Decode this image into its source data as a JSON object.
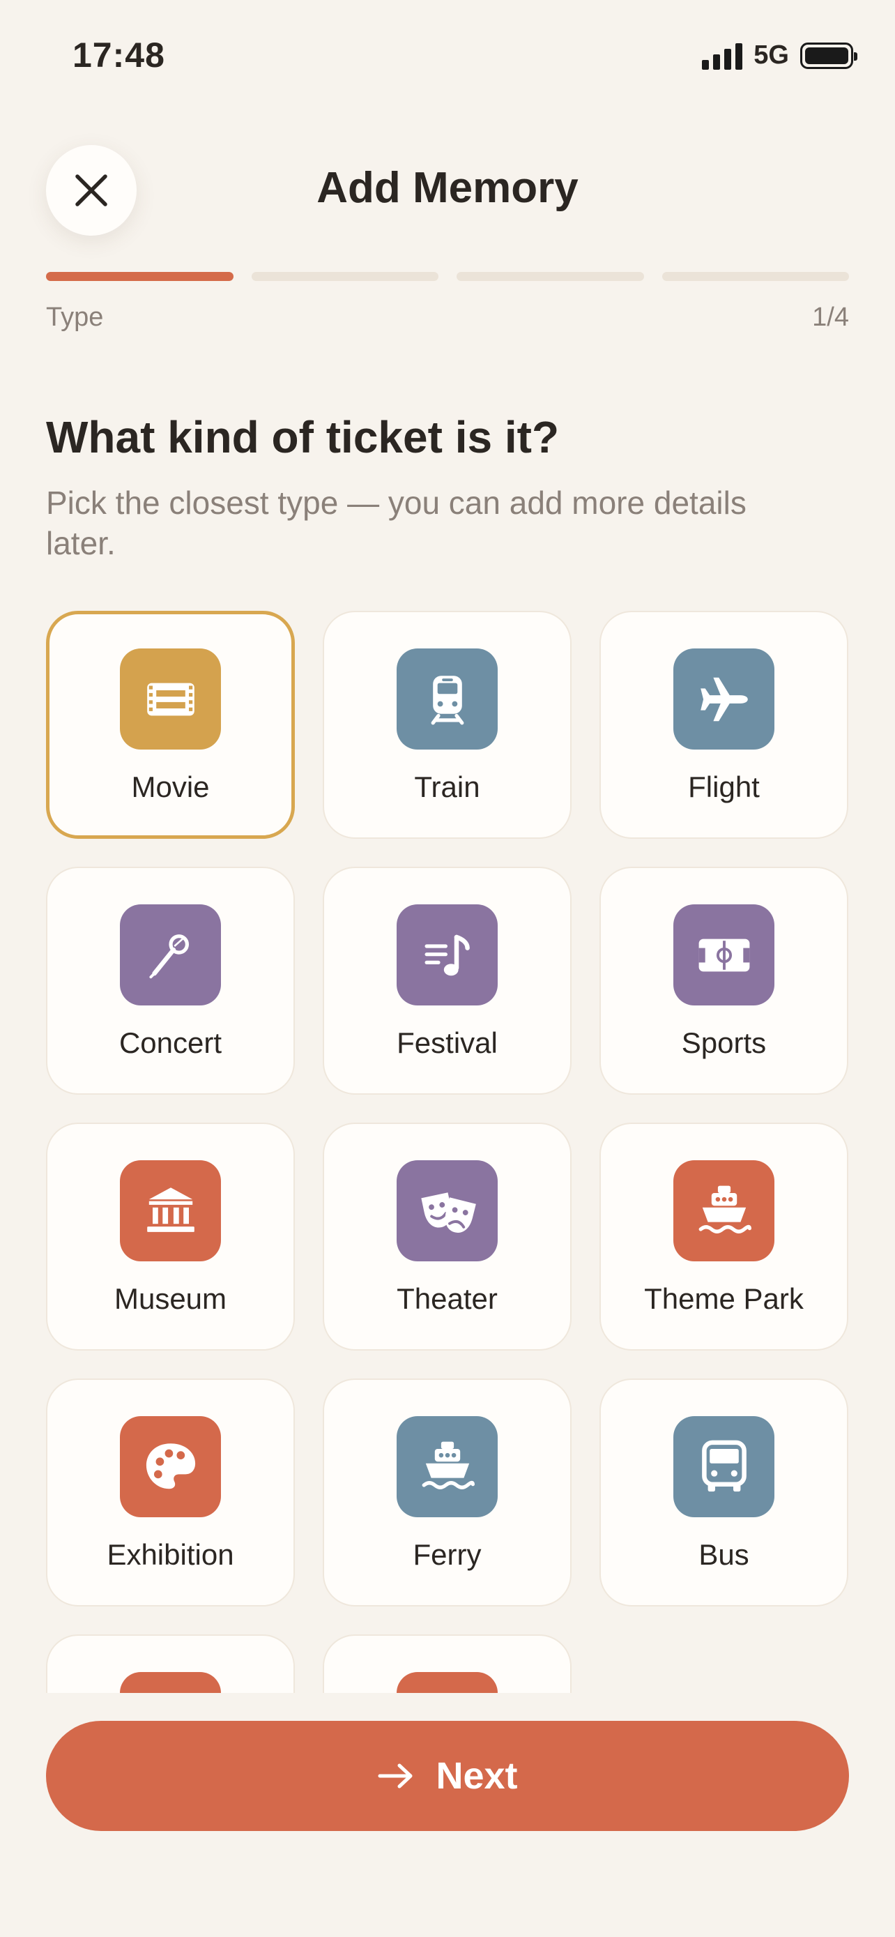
{
  "status_bar": {
    "time": "17:48",
    "network": "5G"
  },
  "header": {
    "title": "Add Memory"
  },
  "progress": {
    "step_label": "Type",
    "step_count": "1/4",
    "total_steps": 4,
    "current_step": 1
  },
  "prompt": {
    "question": "What kind of ticket is it?",
    "subtitle": "Pick the closest type — you can add more details later."
  },
  "ticket_types": [
    {
      "label": "Movie",
      "icon": "film-icon",
      "color": "#d4a24e",
      "selected": true
    },
    {
      "label": "Train",
      "icon": "train-icon",
      "color": "#6e8fa4",
      "selected": false
    },
    {
      "label": "Flight",
      "icon": "airplane-icon",
      "color": "#6e8fa4",
      "selected": false
    },
    {
      "label": "Concert",
      "icon": "microphone-icon",
      "color": "#8a74a0",
      "selected": false
    },
    {
      "label": "Festival",
      "icon": "music-note-icon",
      "color": "#8a74a0",
      "selected": false
    },
    {
      "label": "Sports",
      "icon": "stadium-icon",
      "color": "#8a74a0",
      "selected": false
    },
    {
      "label": "Museum",
      "icon": "museum-icon",
      "color": "#d4694b",
      "selected": false
    },
    {
      "label": "Theater",
      "icon": "theater-masks-icon",
      "color": "#8a74a0",
      "selected": false
    },
    {
      "label": "Theme Park",
      "icon": "ship-icon",
      "color": "#d4694b",
      "selected": false
    },
    {
      "label": "Exhibition",
      "icon": "palette-icon",
      "color": "#d4694b",
      "selected": false
    },
    {
      "label": "Ferry",
      "icon": "ferry-icon",
      "color": "#6e8fa4",
      "selected": false
    },
    {
      "label": "Bus",
      "icon": "bus-icon",
      "color": "#6e8fa4",
      "selected": false
    },
    {
      "label": "",
      "icon": "partial-icon",
      "color": "#d4694b",
      "selected": false
    },
    {
      "label": "",
      "icon": "partial-icon",
      "color": "#d4694b",
      "selected": false
    }
  ],
  "footer": {
    "next_label": "Next"
  }
}
